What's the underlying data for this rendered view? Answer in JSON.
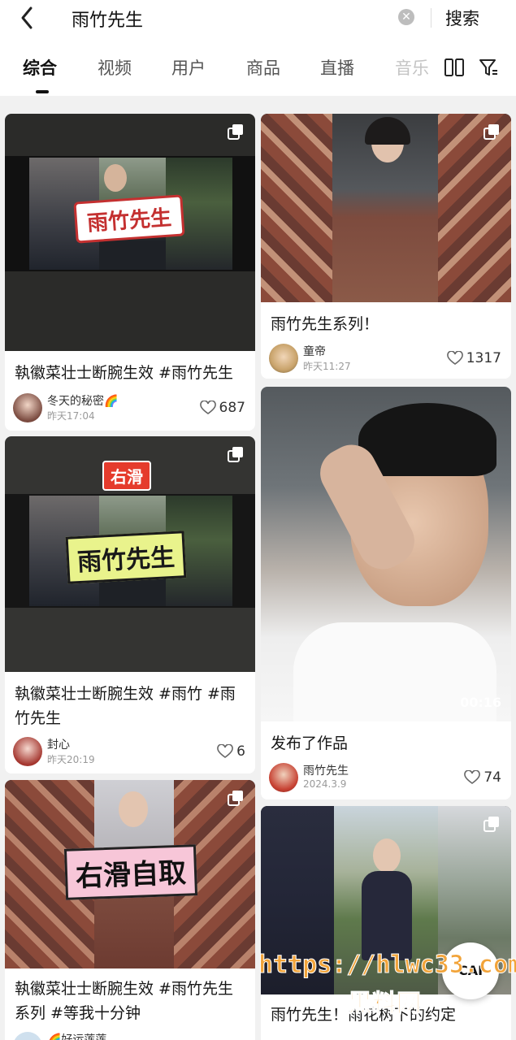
{
  "search": {
    "query": "雨竹先生",
    "submit_label": "搜索"
  },
  "tabs": [
    {
      "label": "综合"
    },
    {
      "label": "视频"
    },
    {
      "label": "用户"
    },
    {
      "label": "商品"
    },
    {
      "label": "直播"
    },
    {
      "label": "音乐"
    }
  ],
  "left_column": [
    {
      "overlay_text": "雨竹先生",
      "title": "執徽菜壮士断腕生效 #雨竹先生",
      "author": "冬天的秘密🌈",
      "time": "昨天17:04",
      "likes": "687"
    },
    {
      "overlay_top": "右滑",
      "overlay_text": "雨竹先生",
      "title_line1": "執徽菜壮士断腕生效 #雨竹 #雨",
      "title_line2": "竹先生",
      "author": "封心",
      "time": "昨天20:19",
      "likes": "6"
    },
    {
      "overlay_text": "右滑自取",
      "title_line1": "執徽菜壮士断腕生效 #雨竹先生",
      "title_line2": "系列 #等我十分钟",
      "author": "🌈好运莲莲"
    }
  ],
  "right_column": [
    {
      "title": "雨竹先生系列！",
      "author": "童帝",
      "time": "昨天11:27",
      "likes": "1317"
    },
    {
      "duration": "00:16",
      "title": "发布了作品",
      "author": "雨竹先生",
      "time": "2024.3.9",
      "likes": "74"
    },
    {
      "title": "雨竹先生！雨花树下的约定"
    }
  ],
  "watermark": {
    "url": "https://hlwc33.com",
    "site": "黑料网",
    "badge": "CAI"
  }
}
